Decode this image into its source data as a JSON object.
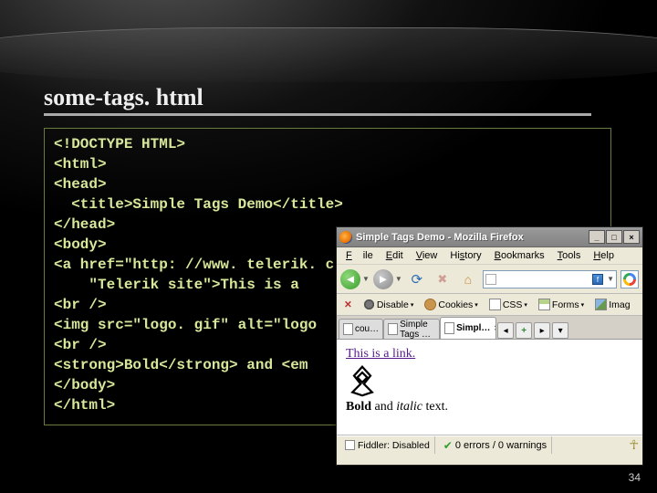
{
  "slide": {
    "title": "some-tags. html",
    "page_number": "34"
  },
  "code_lines": [
    "<!DOCTYPE HTML>",
    "<html>",
    "<head>",
    "  <title>Simple Tags Demo</title>",
    "</head>",
    "<body>",
    "<a href=\"http: //www. telerik. c",
    "    \"Telerik site\">This is a ",
    "<br />",
    "<img src=\"logo. gif\" alt=\"logo",
    "<br />",
    "<strong>Bold</strong> and <em",
    "</body>",
    "</html>"
  ],
  "browser": {
    "window_title": "Simple Tags Demo - Mozilla Firefox",
    "menus": {
      "file": "File",
      "edit": "Edit",
      "view": "View",
      "history": "History",
      "bookmarks": "Bookmarks",
      "tools": "Tools",
      "help": "Help"
    },
    "url_badge": "f",
    "webdev": {
      "disable": "Disable",
      "cookies": "Cookies",
      "css": "CSS",
      "forms": "Forms",
      "images": "Imag"
    },
    "tabs": {
      "t1": "cou…",
      "t2": "Simple Tags …",
      "t3": "Simpl…"
    },
    "page": {
      "link_text": "This is a link.",
      "bold": "Bold",
      "and": " and ",
      "italic": "italic",
      "tail": " text."
    },
    "status": {
      "fiddler": "Fiddler: Disabled",
      "errors": "0 errors / 0 warnings"
    }
  }
}
